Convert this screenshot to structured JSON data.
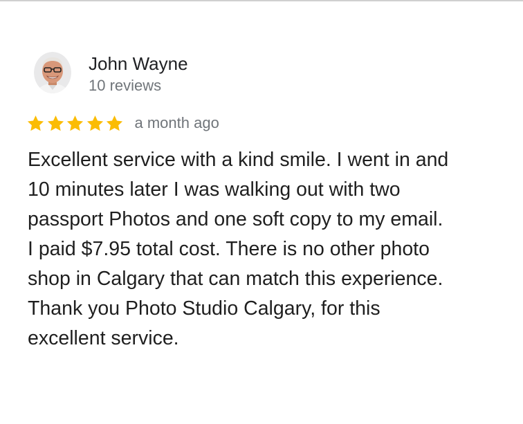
{
  "reviewer": {
    "name": "John Wayne",
    "review_count": "10 reviews",
    "avatar_icon": "avatar-photo"
  },
  "rating": {
    "stars": 5,
    "max_stars": 5,
    "star_icon": "star-icon",
    "star_color": "#fbbc04",
    "date": "a month ago"
  },
  "review": {
    "text": "Excellent service with a kind smile. I went in and\n10 minutes later I was walking out with two\npassport Photos and one soft copy to my email.\nI paid $7.95 total cost. There is no other photo\nshop in Calgary that can match this experience.\nThank you Photo Studio Calgary, for this\nexcellent service."
  }
}
